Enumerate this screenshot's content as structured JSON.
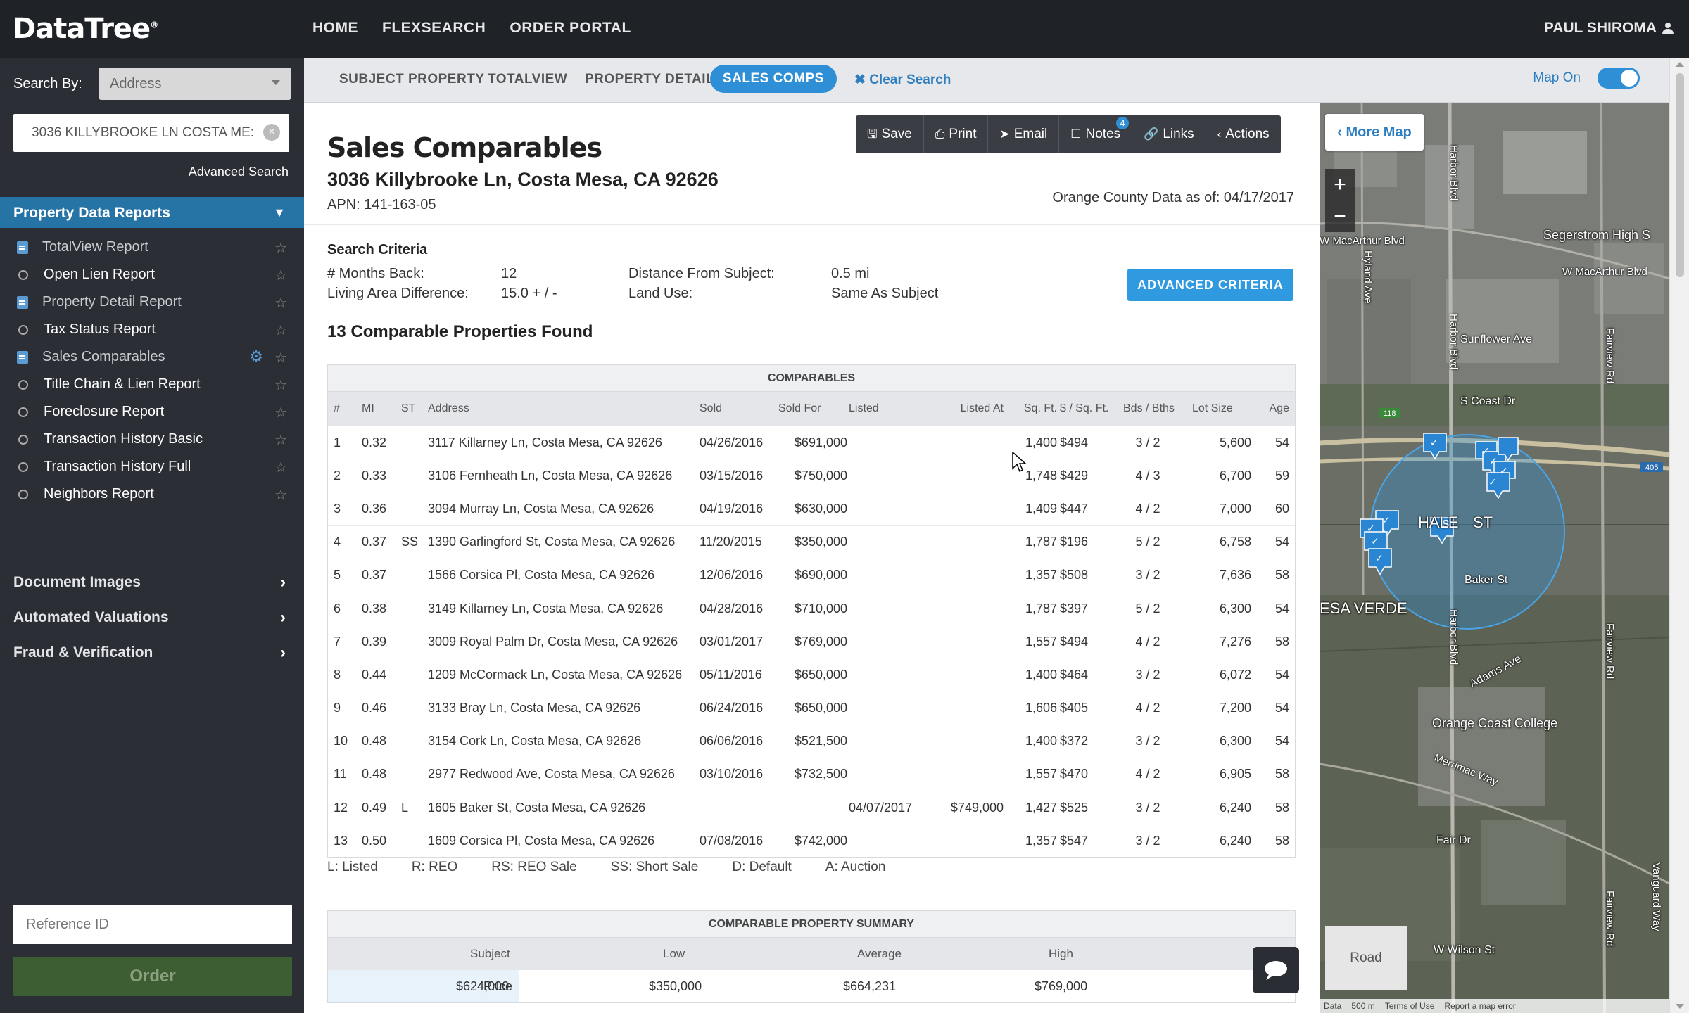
{
  "app": {
    "logo": "DataTree",
    "logo_mark": "®"
  },
  "topnav": [
    "HOME",
    "FLEXSEARCH",
    "ORDER PORTAL"
  ],
  "user": {
    "name": "PAUL SHIROMA",
    "icon": "user-icon"
  },
  "sidebar": {
    "search_by_label": "Search By:",
    "search_by_value": "Address",
    "address_value": "3036 KILLYBROOKE LN COSTA ME:",
    "advanced_search": "Advanced Search",
    "pdr_header": "Property Data Reports",
    "reports": [
      {
        "label": "TotalView Report",
        "icon": "document-icon",
        "dim": true
      },
      {
        "label": "Open Lien Report",
        "icon": "circle-icon",
        "dim": false
      },
      {
        "label": "Property Detail Report",
        "icon": "document-icon",
        "dim": true
      },
      {
        "label": "Tax Status Report",
        "icon": "circle-icon",
        "dim": false
      },
      {
        "label": "Sales Comparables",
        "icon": "document-icon",
        "dim": true
      },
      {
        "label": "Title Chain & Lien Report",
        "icon": "circle-icon",
        "dim": false
      },
      {
        "label": "Foreclosure Report",
        "icon": "circle-icon",
        "dim": false
      },
      {
        "label": "Transaction History Basic",
        "icon": "circle-icon",
        "dim": false
      },
      {
        "label": "Transaction History Full",
        "icon": "circle-icon",
        "dim": false
      },
      {
        "label": "Neighbors Report",
        "icon": "circle-icon",
        "dim": false
      }
    ],
    "sections": [
      "Document Images",
      "Automated Valuations",
      "Fraud & Verification"
    ],
    "reference_placeholder": "Reference ID",
    "order_label": "Order"
  },
  "subnav": {
    "tabs": [
      "SUBJECT PROPERTY",
      "TOTALVIEW",
      "PROPERTY DETAIL",
      "SALES COMPS"
    ],
    "active_tab": "SALES COMPS",
    "clear_search": "Clear Search",
    "map_on": "Map On"
  },
  "main": {
    "title": "Sales Comparables",
    "address": "3036 Killybrooke Ln, Costa Mesa, CA 92626",
    "apn": "APN: 141-163-05",
    "as_of": "Orange County Data as of: 04/17/2017",
    "toolbar": [
      {
        "label": "Save",
        "icon": "save-icon",
        "glyph": "🖫"
      },
      {
        "label": "Print",
        "icon": "print-icon",
        "glyph": "⎙"
      },
      {
        "label": "Email",
        "icon": "send-icon",
        "glyph": "➤"
      },
      {
        "label": "Notes",
        "icon": "notes-icon",
        "glyph": "☐",
        "badge": "4"
      },
      {
        "label": "Links",
        "icon": "link-icon",
        "glyph": "🔗"
      },
      {
        "label": "Actions",
        "icon": "chevron-left-icon",
        "glyph": "‹"
      }
    ],
    "search_criteria": {
      "title": "Search Criteria",
      "months_back_label": "# Months Back:",
      "months_back": "12",
      "living_area_label": "Living Area Difference:",
      "living_area": "15.0 + / -",
      "distance_label": "Distance From Subject:",
      "distance": "0.5 mi",
      "land_use_label": "Land Use:",
      "land_use": "Same As Subject"
    },
    "advanced_criteria": "ADVANCED CRITERIA",
    "found": "13 Comparable Properties Found",
    "comparables": {
      "caption": "COMPARABLES",
      "headers": [
        "#",
        "MI",
        "ST",
        "Address",
        "Sold",
        "Sold For",
        "Listed",
        "Listed At",
        "Sq. Ft.",
        "$ / Sq. Ft.",
        "Bds / Bths",
        "Lot Size",
        "Age"
      ],
      "rows": [
        [
          "1",
          "0.32",
          "",
          "3117 Killarney Ln, Costa Mesa, CA 92626",
          "04/26/2016",
          "$691,000",
          "",
          "",
          "1,400",
          "$494",
          "3 / 2",
          "5,600",
          "54"
        ],
        [
          "2",
          "0.33",
          "",
          "3106 Fernheath Ln, Costa Mesa, CA 92626",
          "03/15/2016",
          "$750,000",
          "",
          "",
          "1,748",
          "$429",
          "4 / 3",
          "6,700",
          "59"
        ],
        [
          "3",
          "0.36",
          "",
          "3094 Murray Ln, Costa Mesa, CA 92626",
          "04/19/2016",
          "$630,000",
          "",
          "",
          "1,409",
          "$447",
          "4 / 2",
          "7,000",
          "60"
        ],
        [
          "4",
          "0.37",
          "SS",
          "1390 Garlingford St, Costa Mesa, CA 92626",
          "11/20/2015",
          "$350,000",
          "",
          "",
          "1,787",
          "$196",
          "5 / 2",
          "6,758",
          "54"
        ],
        [
          "5",
          "0.37",
          "",
          "1566 Corsica Pl, Costa Mesa, CA 92626",
          "12/06/2016",
          "$690,000",
          "",
          "",
          "1,357",
          "$508",
          "3 / 2",
          "7,636",
          "58"
        ],
        [
          "6",
          "0.38",
          "",
          "3149 Killarney Ln, Costa Mesa, CA 92626",
          "04/28/2016",
          "$710,000",
          "",
          "",
          "1,787",
          "$397",
          "5 / 2",
          "6,300",
          "54"
        ],
        [
          "7",
          "0.39",
          "",
          "3009 Royal Palm Dr, Costa Mesa, CA 92626",
          "03/01/2017",
          "$769,000",
          "",
          "",
          "1,557",
          "$494",
          "4 / 2",
          "7,276",
          "58"
        ],
        [
          "8",
          "0.44",
          "",
          "1209 McCormack Ln, Costa Mesa, CA 92626",
          "05/11/2016",
          "$650,000",
          "",
          "",
          "1,400",
          "$464",
          "3 / 2",
          "6,072",
          "54"
        ],
        [
          "9",
          "0.46",
          "",
          "3133 Bray Ln, Costa Mesa, CA 92626",
          "06/24/2016",
          "$650,000",
          "",
          "",
          "1,606",
          "$405",
          "4 / 2",
          "7,200",
          "54"
        ],
        [
          "10",
          "0.48",
          "",
          "3154 Cork Ln, Costa Mesa, CA 92626",
          "06/06/2016",
          "$521,500",
          "",
          "",
          "1,400",
          "$372",
          "3 / 2",
          "6,300",
          "54"
        ],
        [
          "11",
          "0.48",
          "",
          "2977 Redwood Ave, Costa Mesa, CA 92626",
          "03/10/2016",
          "$732,500",
          "",
          "",
          "1,557",
          "$470",
          "4 / 2",
          "6,905",
          "58"
        ],
        [
          "12",
          "0.49",
          "L",
          "1605 Baker St, Costa Mesa, CA 92626",
          "",
          "",
          "04/07/2017",
          "$749,000",
          "1,427",
          "$525",
          "3 / 2",
          "6,240",
          "58"
        ],
        [
          "13",
          "0.50",
          "",
          "1609 Corsica Pl, Costa Mesa, CA 92626",
          "07/08/2016",
          "$742,000",
          "",
          "",
          "1,357",
          "$547",
          "3 / 2",
          "6,240",
          "58"
        ]
      ]
    },
    "legend": [
      "L: Listed",
      "R: REO",
      "RS: REO Sale",
      "SS: Short Sale",
      "D: Default",
      "A: Auction"
    ],
    "summary": {
      "caption": "COMPARABLE PROPERTY SUMMARY",
      "headers": [
        "",
        "Subject",
        "Low",
        "Average",
        "High"
      ],
      "rows": [
        [
          "Price",
          "$624,000",
          "$350,000",
          "$664,231",
          "$769,000"
        ]
      ]
    }
  },
  "map": {
    "more_map": "More Map",
    "zoom_in": "+",
    "zoom_out": "−",
    "road": "Road",
    "labels": {
      "segerstrom": "Segerstrom High S",
      "macarthur_w": "W MacArthur Blvd",
      "macarthur_e": "W MacArthur Blvd",
      "sunflower": "Sunflower Ave",
      "coast": "S Coast Dr",
      "hale": "HALE",
      "st": "ST",
      "baker": "Baker St",
      "mesa_verde": "ESA VERDE",
      "adams": "Adams Ave",
      "occ": "Orange Coast College",
      "merrimac": "Merrimac Way",
      "fair": "Fair Dr",
      "wilson": "W Wilson St",
      "harbor": "Harbor Blvd",
      "fairview": "Fairview Rd",
      "hyland": "Hyland Ave",
      "vanguard": "Vanguard Way",
      "fwy405": "405",
      "fwy118": "118",
      "subject_marker": "S"
    },
    "footer": [
      "Data",
      "500 m",
      "Terms of Use",
      "Report a map error"
    ]
  }
}
